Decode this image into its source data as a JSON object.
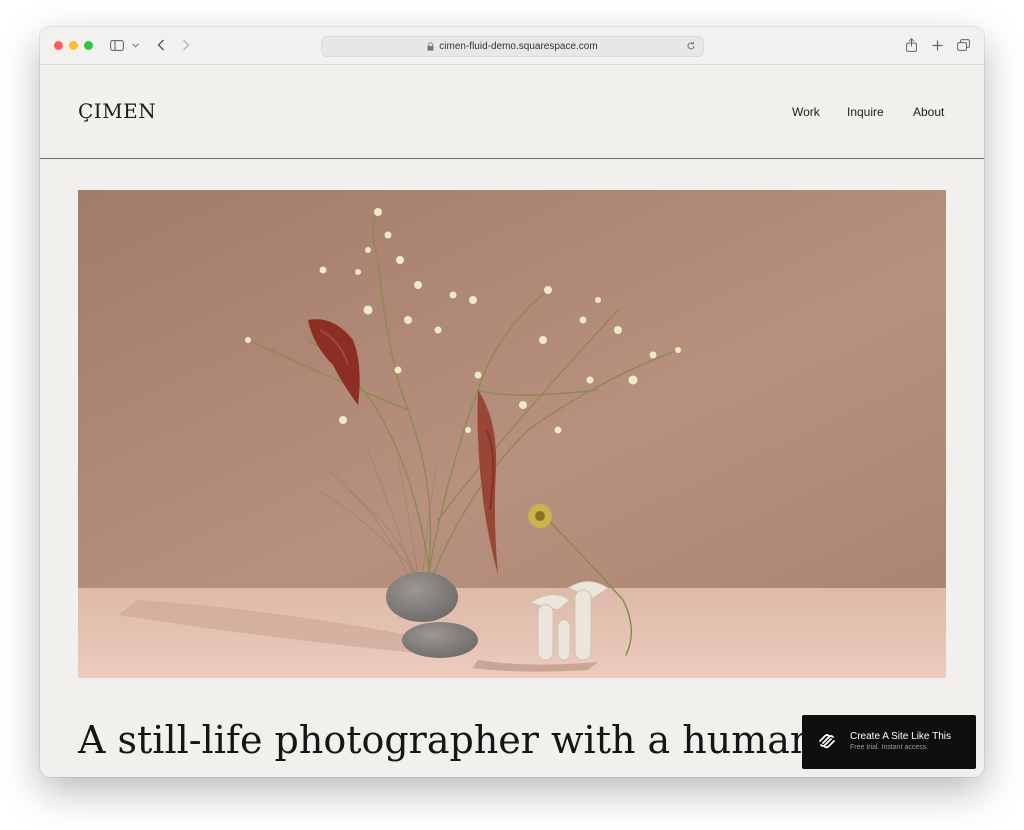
{
  "browser": {
    "url": "cimen-fluid-demo.squarespace.com",
    "icons": [
      "close-light",
      "minimize-light",
      "zoom-light",
      "sidebar-icon",
      "chevron-down-icon",
      "back-icon",
      "forward-icon",
      "lock-icon",
      "reload-icon",
      "share-icon",
      "plus-icon",
      "tabs-icon"
    ],
    "traffic_colors": [
      "#ff5f57",
      "#febc2e",
      "#28c840"
    ]
  },
  "site": {
    "logo": "ÇIMEN",
    "nav": [
      "Work",
      "Inquire",
      "About"
    ]
  },
  "hero": {
    "image": "still-life floral arrangement with stones and mushrooms",
    "colors": {
      "wall": "#a98170",
      "floor": "#e6c4b4"
    }
  },
  "headline": "A still-life photographer with a human hea",
  "badge": {
    "title": "Create A Site Like This",
    "subtitle": "Free trial. Instant access.",
    "icon": "squarespace-logo-icon"
  }
}
